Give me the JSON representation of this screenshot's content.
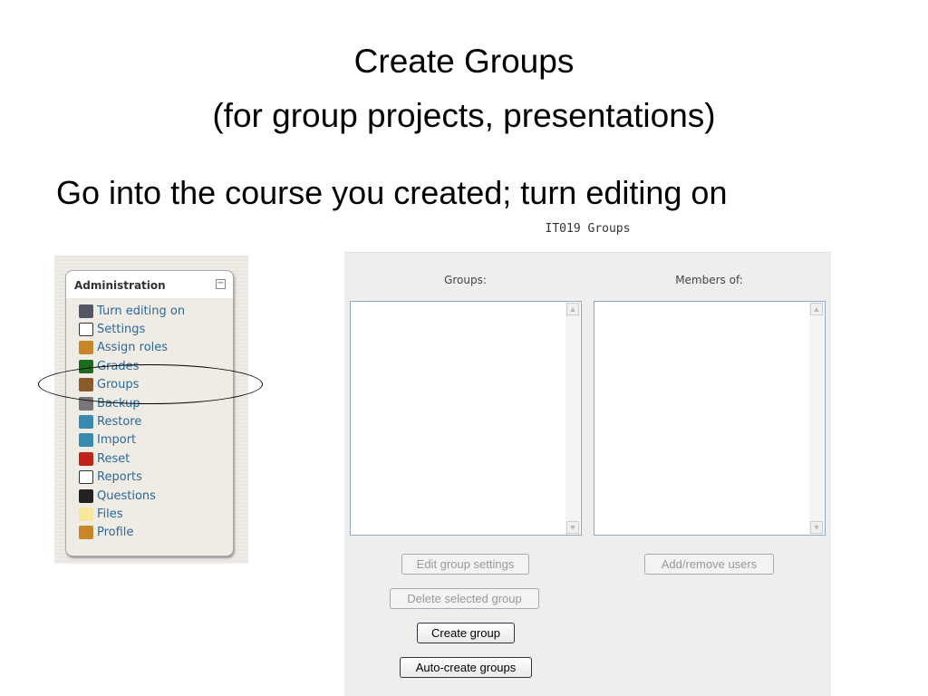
{
  "slide": {
    "title_line1": "Create Groups",
    "title_line2": "(for group projects, presentations)",
    "subtitle": "Go into the course you created; turn editing on"
  },
  "admin_block": {
    "heading": "Administration",
    "collapse_symbol": "−",
    "items": [
      {
        "label": "Turn editing on",
        "icon": "edit-icon",
        "color": "#556"
      },
      {
        "label": "Settings",
        "icon": "settings-icon",
        "color": "#fff"
      },
      {
        "label": "Assign roles",
        "icon": "roles-icon",
        "color": "#c8862a"
      },
      {
        "label": "Grades",
        "icon": "grades-icon",
        "color": "#1d6b1d"
      },
      {
        "label": "Groups",
        "icon": "groups-icon",
        "color": "#8a5a2a"
      },
      {
        "label": "Backup",
        "icon": "backup-icon",
        "color": "#777"
      },
      {
        "label": "Restore",
        "icon": "restore-icon",
        "color": "#3a8ab0"
      },
      {
        "label": "Import",
        "icon": "import-icon",
        "color": "#3a8ab0"
      },
      {
        "label": "Reset",
        "icon": "reset-icon",
        "color": "#c0231a"
      },
      {
        "label": "Reports",
        "icon": "reports-icon",
        "color": "#fff"
      },
      {
        "label": "Questions",
        "icon": "questions-icon",
        "color": "#222"
      },
      {
        "label": "Files",
        "icon": "folder-icon",
        "color": "#f6e79a"
      },
      {
        "label": "Profile",
        "icon": "profile-icon",
        "color": "#c8862a"
      }
    ]
  },
  "groups_page": {
    "title": "IT019 Groups",
    "groups_label": "Groups:",
    "members_label": "Members of:",
    "buttons": {
      "edit": "Edit group settings",
      "add_remove": "Add/remove users",
      "delete": "Delete selected group",
      "create": "Create group",
      "auto_create": "Auto-create groups"
    }
  }
}
